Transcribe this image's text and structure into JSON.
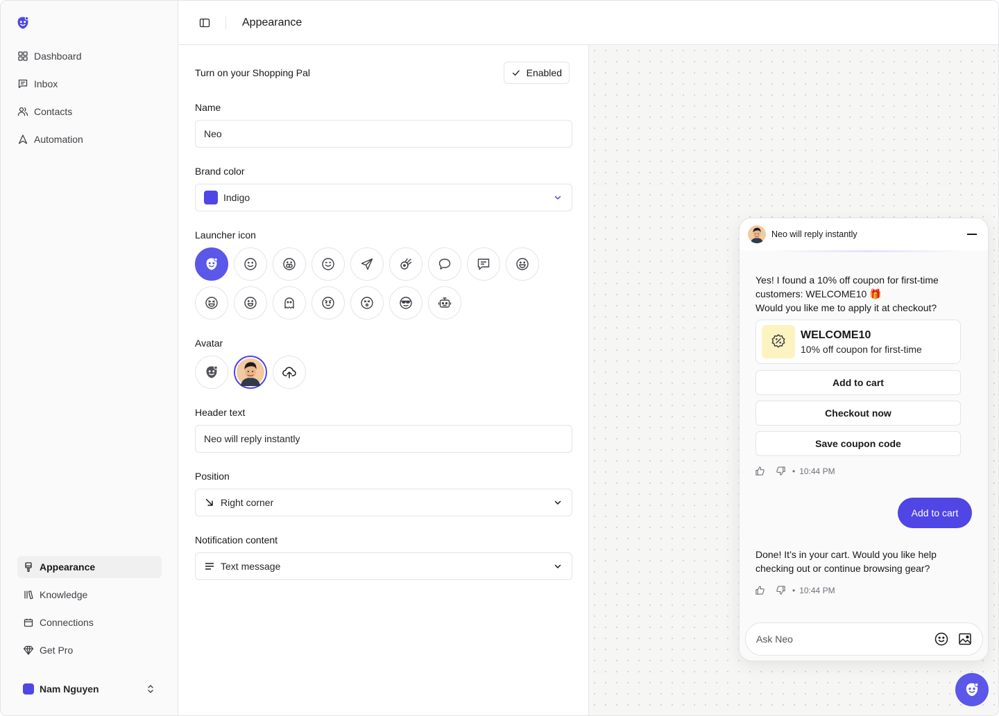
{
  "sidebar": {
    "top_items": [
      {
        "label": "Dashboard",
        "icon": "grid-icon"
      },
      {
        "label": "Inbox",
        "icon": "message-square-icon"
      },
      {
        "label": "Contacts",
        "icon": "users-icon"
      },
      {
        "label": "Automation",
        "icon": "triangle-icon"
      }
    ],
    "bottom_items": [
      {
        "label": "Appearance",
        "icon": "brush-icon",
        "active": true
      },
      {
        "label": "Knowledge",
        "icon": "library-icon"
      },
      {
        "label": "Connections",
        "icon": "calendar-icon"
      },
      {
        "label": "Get Pro",
        "icon": "gem-icon"
      }
    ],
    "user": {
      "name": "Nam Nguyen"
    }
  },
  "header": {
    "title": "Appearance"
  },
  "form": {
    "toggle_label": "Turn on your Shopping Pal",
    "toggle_button": "Enabled",
    "name_label": "Name",
    "name_value": "Neo",
    "brand_color_label": "Brand color",
    "brand_color_value": "Indigo",
    "launcher_icon_label": "Launcher icon",
    "avatar_label": "Avatar",
    "header_text_label": "Header text",
    "header_text_value": "Neo will reply instantly",
    "position_label": "Position",
    "position_value": "Right corner",
    "notification_label": "Notification content",
    "notification_value": "Text message"
  },
  "chat": {
    "header_text": "Neo will reply instantly",
    "bot_message_1_line1": "Yes! I found a 10% off coupon for first-time customers: WELCOME10 🎁",
    "bot_message_1_line2": "Would you like me to apply it at checkout?",
    "coupon_code": "WELCOME10",
    "coupon_desc": "10% off coupon for first-time",
    "buttons": [
      "Add to cart",
      "Checkout now",
      "Save coupon code"
    ],
    "timestamp_1": "10:44 PM",
    "user_message": "Add to cart",
    "bot_message_2": "Done! It’s in your cart. Would you like help checking out or continue browsing gear?",
    "timestamp_2": "10:44 PM",
    "composer_placeholder": "Ask Neo"
  },
  "colors": {
    "brand": "#4f46e5",
    "launcher": "#5b57e8",
    "coupon_bg": "#fdf3c0"
  }
}
